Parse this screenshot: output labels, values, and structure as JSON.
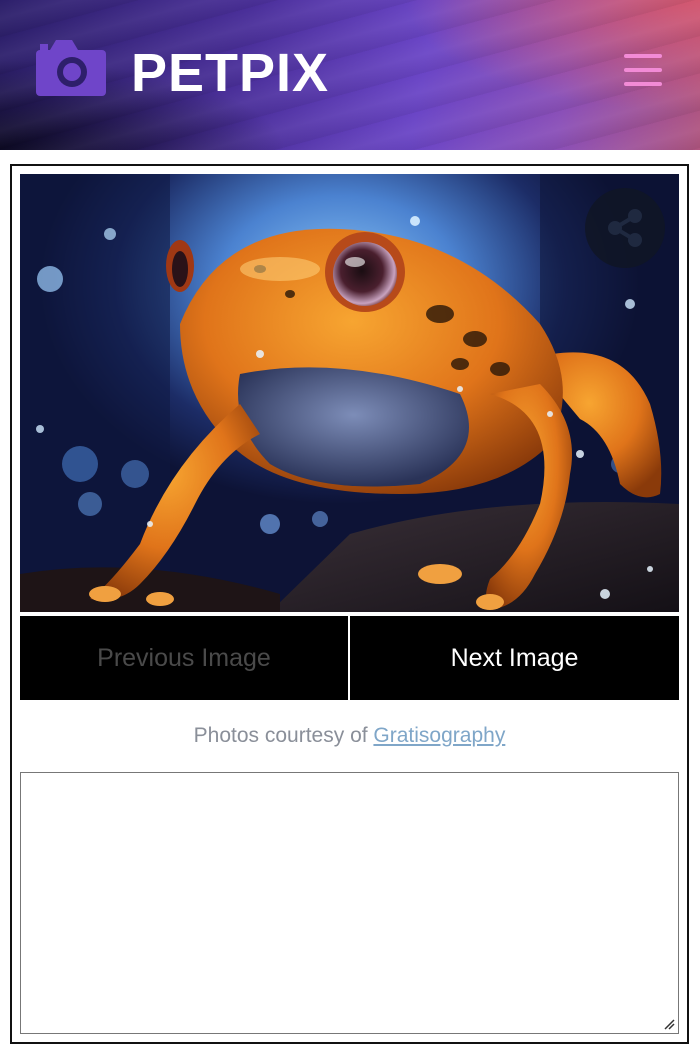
{
  "app": {
    "brand": "PETPIX"
  },
  "header": {
    "logo_icon": "camera-icon",
    "menu_icon": "hamburger-menu-icon"
  },
  "viewer": {
    "photo_subject": "orange-frog-photo",
    "share_icon": "share-icon",
    "prev_label": "Previous Image",
    "next_label": "Next Image",
    "prev_enabled": false
  },
  "credit": {
    "prefix": "Photos courtesy of ",
    "link_text": "Gratisography"
  },
  "notes": {
    "value": ""
  },
  "colors": {
    "brand_text": "#ffffff",
    "menu_icon": "#f28bd6",
    "logo_icon": "#6f45c9",
    "button_bg": "#000000",
    "link": "#7fa6c8"
  }
}
